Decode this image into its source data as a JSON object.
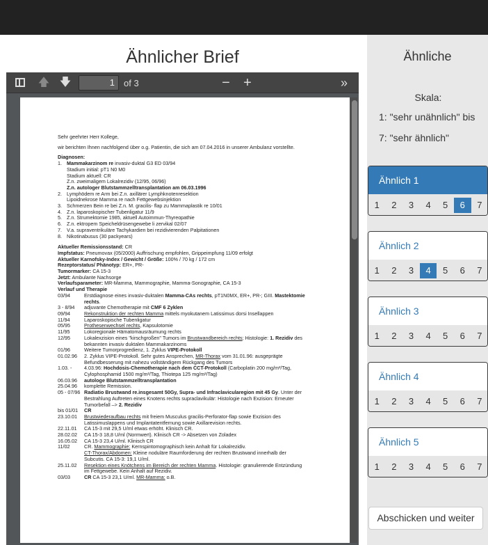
{
  "left_title": "Ähnlicher Brief",
  "pdf_toolbar": {
    "page_value": "1",
    "page_of": "of 3"
  },
  "document": {
    "greeting": "Sehr geehrter Herr Kollege,",
    "intro": "wir berichten Ihnen nachfolgend über o.g. Patientin, die sich am 07.04.2016 in unserer Ambulanz vorstellte.",
    "diagnoses_title": "Diagnosen:",
    "diag1_name": "Mammakarzinom re",
    "diag1_rest": "invasiv-duktal G3 ED 03/94",
    "diag1_l1": "Stadium initial: pT1 N0 M0",
    "diag1_l2": "Stadium aktuell: CR",
    "diag1_l3": "Z.n. zweimaligem Lokalrezidiv (12/95, 06/96)",
    "diag1_l4": "Z.n. autologer Blutstammzelltransplantation am 06.03.1996",
    "diag2": "Lymphödem re Arm bei Z.n. axillärer Lymphknotenresektion",
    "diag2_l1": "Lipoidnekrose Mamma re nach Fettgewebsinjektion",
    "diag3": "Schmerzen Bein re bei Z.n. M. gracilis- flap zu Mammaplastik re 10/01",
    "diag4": "Z.n. laparoskopischer Tubenligatur 11/9",
    "diag5": "Z.n. Strumektomie 1985, aktuell Autoimmun-Thyreopathie",
    "diag6": "Z.n. ektropem Speicheldrüsengewebe li zervikal 02/07",
    "diag7": "V.a. supraventrikuläre Tachykardien bei rezidivierenden Palpitationen",
    "diag8": "Nikotinabusus (30 packyears)",
    "remission_label": "Aktueller Remissionsstand:",
    "remission_value": "CR",
    "impf_label": "Impfstatus:",
    "impf_value": "Pneumovax (05/2000) Auffrischung empfohlen, Grippeimpfung 11/09 erfolgt",
    "karnofsky_label": "Aktueller Karnofsky-Index / Gewicht / Größe:",
    "karnofsky_value": "100% / 70 kg / 172 cm",
    "rezeptor_label": "Rezeptorstatus/ Phänotyp:",
    "rezeptor_value": "ER+, PR-",
    "tumor_label": "Tumormarker:",
    "tumor_value": "CA 15-3",
    "jetzt_label": "Jetzt:",
    "jetzt_value": "Ambulante Nachsorge",
    "verlauf_label": "Verlaufsparameter:",
    "verlauf_value": "MR-Mamma, Mammographie, Mamma-Sonographie, CA 15-3",
    "therapie_title": "Verlauf und Therapie",
    "t1_d": "03/94",
    "t1_a": "Erstdiagnose eines invasiv-duktalen",
    "t1_b": "Mamma-CAs rechts",
    "t1_c": ", pT1N0MX, ER+, PR-; GIII.",
    "t1_e": "Mastektomie rechts",
    "t2_d": "3 - 8/94",
    "t2_a": "adjuvante Chemotherapie mit",
    "t2_b": "CMF 6 Zyklen",
    "t3_d": "09/94",
    "t3_a": "Rekonstruktion der rechten Mamma",
    "t3_b": "mittels myokutanem Latissimus dorsi Insellappen",
    "t4_d": "11/94",
    "t4_a": "Laparoskopische Tubenligatur",
    "t5_d": "05/95",
    "t5_a": "Prothesenwechsel rechts",
    "t5_b": ", Kapsulotomie",
    "t6_d": "11/95",
    "t6_a": "Lokoregionale Hämatomausräumung rechts",
    "t7_d": "12/95",
    "t7_a": "Lokalexzision eines \"kirschgroßen\" Tumors im",
    "t7_b": "Brustwandbereich rechts",
    "t7_c": "; Histologie:",
    "t7_e": "1. Rezidiv",
    "t7_f": "des bekannten invasiv duktalen Mammakarzinoms",
    "t8_d": "01/96",
    "t8_a": "Weitere Tumorprogredienz, 1. Zyklus",
    "t8_b": "VIPE-Protokoll",
    "t9_d": "01.02.96",
    "t9_a": "2. Zyklus VIPE-Protokoll. Sehr gutes Ansprechen,",
    "t9_b": "MR-Thorax",
    "t9_c": "vom 31.01.96: ausgeprägte Befundbesserung mit nahezu vollständigem Rückgang des Tumors",
    "t10_d": "1.03. -",
    "t10_a": "4.03.96:",
    "t10_b": "Hochdosis-Chemotherapie nach dem CCT-Protokoll",
    "t10_c": "(Carboplatin 200 mg/m²/Tag, Cylophosphamid 1500 mg/m²/Tag, Thiotepa 125 mg/m²/Tag)",
    "t11_d": "06.03.96",
    "t11_a": "autologe Blutstammzelltransplantation",
    "t12_d": "25.04.96",
    "t12_a": "komplette Remission.",
    "t13_d": "05 - 07/96",
    "t13_a": "Radiatio Brustwand re.insgesamt 50Gy, Supra- und Infraclavicularegion mit 45 Gy",
    "t13_b": ". Unter der Bestrahlung Auftreten eines Knotens rechts supraclavikulär: Histologie nach Exzision: Erneuter Tumorbefall –>",
    "t13_c": "2. Rezidiv",
    "t14_d": "bis 01/01",
    "t14_a": "CR",
    "t15_d": "23.10.01",
    "t15_a": "Brustwiederaufbau rechts",
    "t15_b": "mit freiem Musculus gracilis-Perforator-flap sowie Exzision des Latissimuslappens und Implantatentfernung sowie Axillarevision rechts.",
    "t16_d": "22.11.01",
    "t16_a": "CA 15-3 mit 29,5 U/ml etwas erhöht. Klinisch CR.",
    "t17_d": "28.02.02",
    "t17_a": "CA 15-3 18,8 U/ml (Normwert). Klinisch CR -> Absetzen von Zoladex",
    "t18_d": "16.05.02",
    "t18_a": "CA 15-3 23,4 U/ml. Klinisch CR",
    "t19_d": "11/02",
    "t19_a": "CR.",
    "t19_b": "Mammographie:",
    "t19_c": "Kernspintomographisch kein Anhalt für Lokalrezidiv.",
    "t19_e": "CT-Thorax/Abdomen:",
    "t19_f": "Kleine noduläre Raumforderung der rechten Brustwand innerhalb der Subcutis. CA 15-3: 19,1 U/ml.",
    "t20_d": "25.11.02",
    "t20_a": "Resektion eines Knötchens im Bereich der rechten Mamma",
    "t20_b": ". Histologie: granulierende Entzündung im Fettgewebe. Kein Anhalt auf Rezidiv.",
    "t21_d": "03/03",
    "t21_a": "CR",
    "t21_b": "CA 15-3 23,1 U/ml.",
    "t21_c": "MR-Mamma:",
    "t21_e": "o.B."
  },
  "sidebar": {
    "title": "Ähnliche",
    "scale_title": "Skala:",
    "scale_line1": "1: \"sehr unähnlich\" bis",
    "scale_line2": "7: \"sehr ähnlich\"",
    "groups": [
      {
        "label": "Ähnlich 1",
        "selected": 6,
        "active": true
      },
      {
        "label": "Ähnlich 2",
        "selected": 4,
        "active": false
      },
      {
        "label": "Ähnlich 3",
        "selected": 0,
        "active": false
      },
      {
        "label": "Ähnlich 4",
        "selected": 0,
        "active": false
      },
      {
        "label": "Ähnlich 5",
        "selected": 0,
        "active": false
      }
    ],
    "options": [
      "1",
      "2",
      "3",
      "4",
      "5",
      "6",
      "7"
    ],
    "submit_label": "Abschicken und weiter"
  },
  "colors": {
    "accent": "#337ab7",
    "topbar": "#222222",
    "sidebar_bg": "#e8e8e8"
  }
}
